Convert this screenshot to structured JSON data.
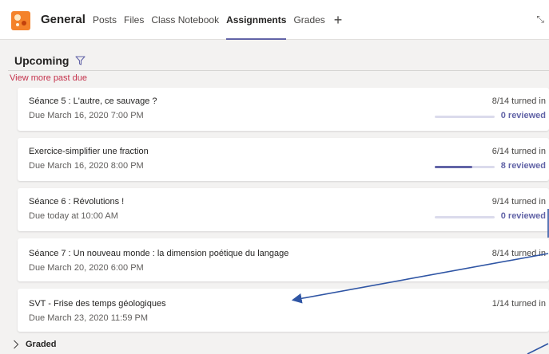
{
  "header": {
    "team_name": "General",
    "tabs": [
      {
        "label": "Posts",
        "active": false
      },
      {
        "label": "Files",
        "active": false
      },
      {
        "label": "Class Notebook",
        "active": false
      },
      {
        "label": "Assignments",
        "active": true
      },
      {
        "label": "Grades",
        "active": false
      }
    ],
    "add_tab_glyph": "+",
    "expand_glyph": "⤡"
  },
  "section": {
    "title": "Upcoming",
    "past_due_link": "View more past due"
  },
  "assignments": [
    {
      "title": "Séance 5 : L'autre, ce sauvage ?",
      "due": "Due March 16, 2020 7:00 PM",
      "turned_in": "8/14 turned in",
      "reviewed": "0 reviewed",
      "reviewed_fraction": 0.0
    },
    {
      "title": "Exercice-simplifier une fraction",
      "due": "Due March 16, 2020 8:00 PM",
      "turned_in": "6/14 turned in",
      "reviewed": "8 reviewed",
      "reviewed_fraction": 0.62
    },
    {
      "title": "Séance 6 : Révolutions !",
      "due": "Due today at 10:00 AM",
      "turned_in": "9/14 turned in",
      "reviewed": "0 reviewed",
      "reviewed_fraction": 0.0
    },
    {
      "title": "Séance 7 : Un nouveau monde : la dimension poétique du langage",
      "due": "Due March 20, 2020 6:00 PM",
      "turned_in": "8/14 turned in"
    },
    {
      "title": "SVT - Frise des temps géologiques",
      "due": "Due March 23, 2020 11:59 PM",
      "turned_in": "1/14 turned in"
    }
  ],
  "graded": {
    "label": "Graded"
  },
  "colors": {
    "accent": "#6264a7",
    "past_due": "#c4314b",
    "team_logo": "#f4822a",
    "annotation_arrow": "#2f55a4"
  },
  "icons": {
    "team": "team-logo-icon",
    "filter": "filter-funnel-icon",
    "add_tab": "plus-icon",
    "expand": "expand-icon",
    "graded": "chevron-right-icon"
  }
}
